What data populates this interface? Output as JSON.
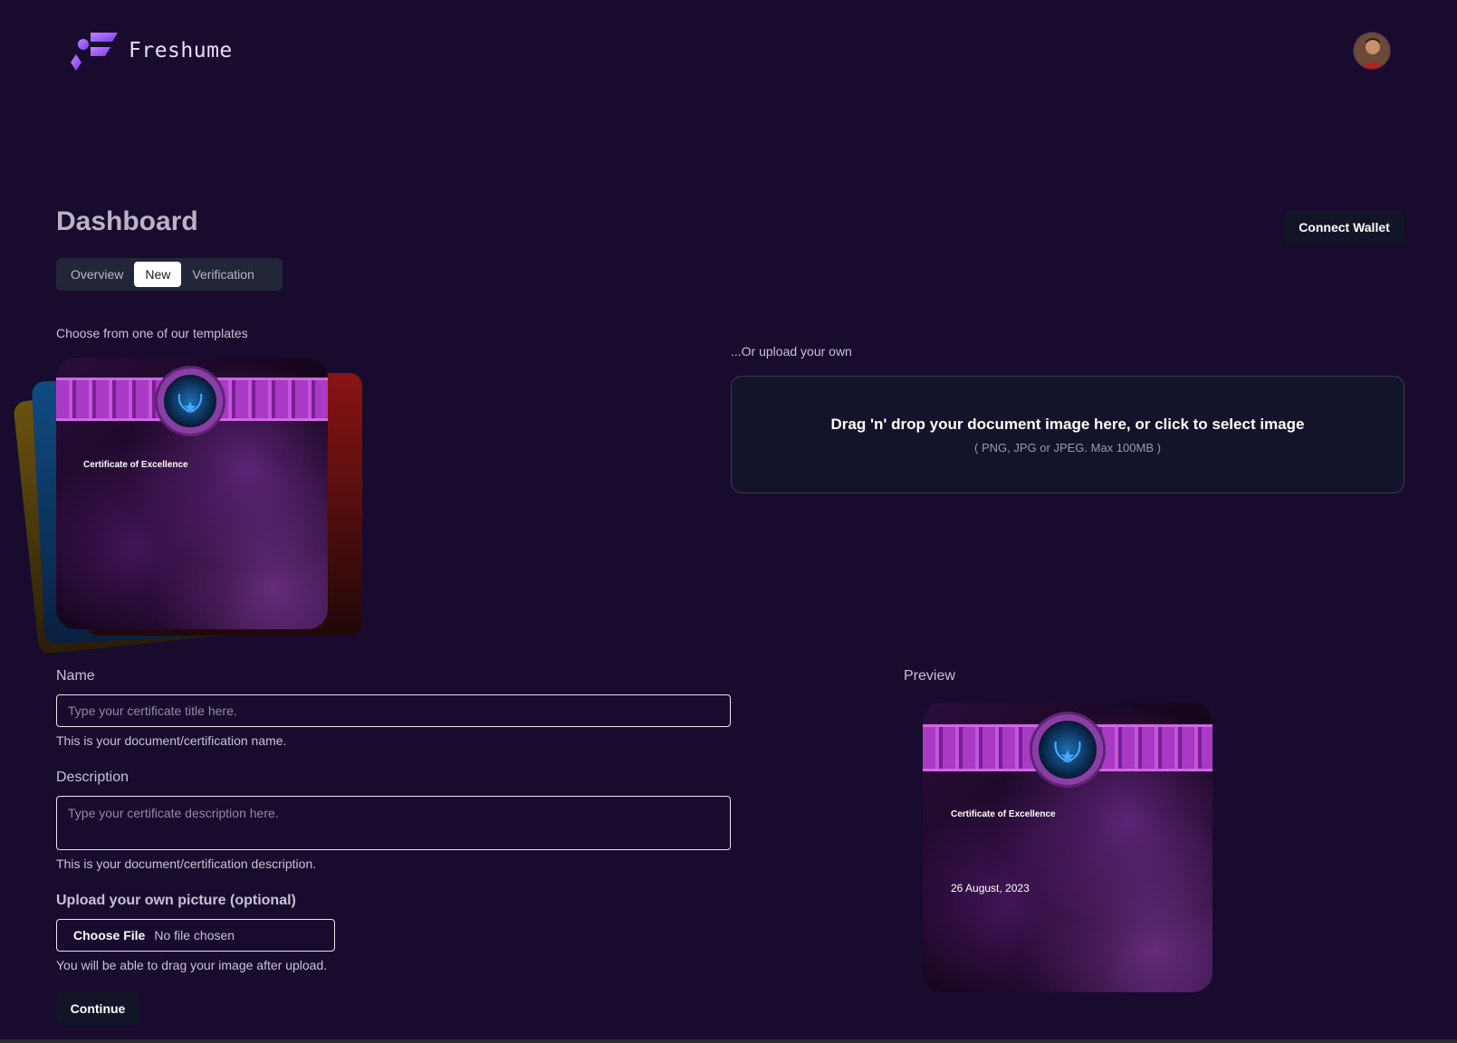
{
  "app": {
    "name": "Freshume",
    "brand_color": "#a855f7"
  },
  "header": {
    "avatar_alt": "User avatar"
  },
  "dashboard": {
    "title": "Dashboard",
    "connect_wallet_label": "Connect Wallet",
    "tabs": [
      {
        "label": "Overview",
        "active": false
      },
      {
        "label": "New",
        "active": true
      },
      {
        "label": "Verification",
        "active": false
      }
    ]
  },
  "templates": {
    "label": "Choose from one of our templates",
    "selected": {
      "title": "Certificate of Excellence"
    }
  },
  "upload": {
    "label": "...Or upload your own",
    "main_text": "Drag 'n' drop your document image here, or click to select image",
    "sub_text": "( PNG, JPG or JPEG. Max 100MB )"
  },
  "form": {
    "name": {
      "label": "Name",
      "placeholder": "Type your certificate title here.",
      "hint": "This is your document/certification name."
    },
    "description": {
      "label": "Description",
      "placeholder": "Type your certificate description here.",
      "hint": "This is your document/certification description."
    },
    "picture": {
      "label": "Upload your own picture (optional)",
      "button_label": "Choose File",
      "status": "No file chosen",
      "hint": "You will be able to drag your image after upload."
    },
    "continue_label": "Continue"
  },
  "preview": {
    "label": "Preview",
    "title": "Certificate of Excellence",
    "date": "26 August, 2023"
  }
}
